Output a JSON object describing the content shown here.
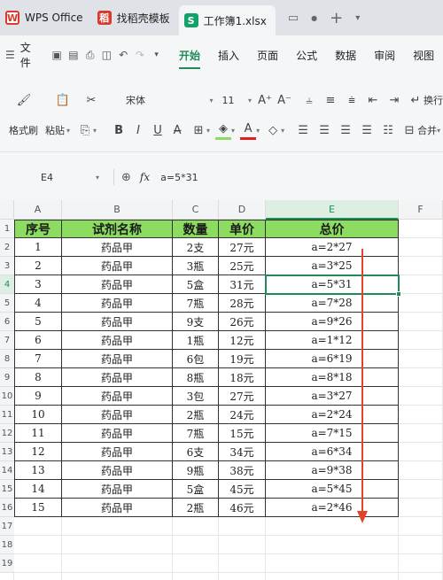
{
  "titlebar": {
    "tabs": [
      {
        "label": "WPS Office",
        "icon": "wps-logo-icon"
      },
      {
        "label": "找稻壳模板",
        "icon": "daoke-icon"
      },
      {
        "label": "工作簿1.xlsx",
        "icon": "spreadsheet-s-icon"
      }
    ],
    "new_tab": "+"
  },
  "menubar": {
    "file_label": "文件",
    "tabs": [
      "开始",
      "插入",
      "页面",
      "公式",
      "数据",
      "审阅",
      "视图"
    ],
    "active_tab": "开始"
  },
  "ribbon": {
    "format_painter": "格式刷",
    "paste": "粘贴",
    "font_name": "宋体",
    "font_size": "11",
    "wrap_text": "换行",
    "merge": "合并",
    "font_color": "#e02020",
    "fill_color": "#8bdc61"
  },
  "formula_bar": {
    "cell_ref": "E4",
    "fx": "fx",
    "formula": "a=5*31"
  },
  "sheet": {
    "columns": [
      "A",
      "B",
      "C",
      "D",
      "E",
      "F"
    ],
    "selected_column": "E",
    "rows": [
      "1",
      "2",
      "3",
      "4",
      "5",
      "6",
      "7",
      "8",
      "9",
      "10",
      "11",
      "12",
      "13",
      "14",
      "15",
      "16",
      "17",
      "18",
      "19"
    ],
    "selected_row": "4",
    "header": [
      "序号",
      "试剂名称",
      "数量",
      "单价",
      "总价"
    ],
    "data": [
      [
        "1",
        "药品甲",
        "2支",
        "27元",
        "a=2*27"
      ],
      [
        "2",
        "药品甲",
        "3瓶",
        "25元",
        "a=3*25"
      ],
      [
        "3",
        "药品甲",
        "5盒",
        "31元",
        "a=5*31"
      ],
      [
        "4",
        "药品甲",
        "7瓶",
        "28元",
        "a=7*28"
      ],
      [
        "5",
        "药品甲",
        "9支",
        "26元",
        "a=9*26"
      ],
      [
        "6",
        "药品甲",
        "1瓶",
        "12元",
        "a=1*12"
      ],
      [
        "7",
        "药品甲",
        "6包",
        "19元",
        "a=6*19"
      ],
      [
        "8",
        "药品甲",
        "8瓶",
        "18元",
        "a=8*18"
      ],
      [
        "9",
        "药品甲",
        "3包",
        "27元",
        "a=3*27"
      ],
      [
        "10",
        "药品甲",
        "2瓶",
        "24元",
        "a=2*24"
      ],
      [
        "11",
        "药品甲",
        "7瓶",
        "15元",
        "a=7*15"
      ],
      [
        "12",
        "药品甲",
        "6支",
        "34元",
        "a=6*34"
      ],
      [
        "13",
        "药品甲",
        "9瓶",
        "38元",
        "a=9*38"
      ],
      [
        "14",
        "药品甲",
        "5盒",
        "45元",
        "a=5*45"
      ],
      [
        "15",
        "药品甲",
        "2瓶",
        "46元",
        "a=2*46"
      ]
    ],
    "header_fill": "#8bdc61",
    "selection_color": "#1e8c5a",
    "arrow_color": "#e0452b"
  }
}
